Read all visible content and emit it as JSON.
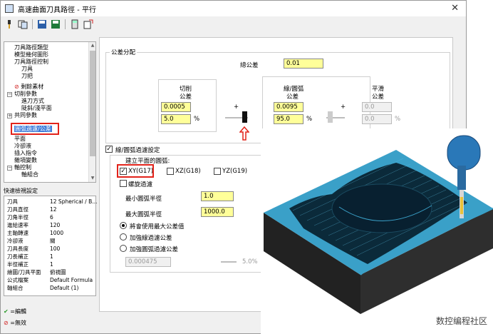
{
  "window": {
    "title": "高速曲面刀具路徑 - 平行"
  },
  "tree": {
    "items": [
      {
        "label": "刀具路徑類型"
      },
      {
        "label": "模型幾何圖形"
      },
      {
        "label": "刀具路徑控制"
      },
      {
        "label": "刀具"
      },
      {
        "label": "刀把"
      },
      {
        "label": "剩餘素材"
      },
      {
        "label": "切削參數"
      },
      {
        "label": "進刀方式"
      },
      {
        "label": "陡斜/淺平面"
      },
      {
        "label": "共同參數"
      },
      {
        "label": "圓弧過濾/公差"
      },
      {
        "label": "平面"
      },
      {
        "label": "冷卻液"
      },
      {
        "label": "插入指令"
      },
      {
        "label": "雜項變數"
      },
      {
        "label": "軸控制"
      },
      {
        "label": "軸組合"
      }
    ]
  },
  "quick_view": {
    "label": "快速檢視設定",
    "rows": [
      {
        "k": "刀具",
        "v": "12 Spherical / B..."
      },
      {
        "k": "刀具直徑",
        "v": "12"
      },
      {
        "k": "刀角半徑",
        "v": "6"
      },
      {
        "k": "進給速率",
        "v": "120"
      },
      {
        "k": "主軸轉速",
        "v": "1000"
      },
      {
        "k": "冷卻液",
        "v": "關"
      },
      {
        "k": "刀具長度",
        "v": "100"
      },
      {
        "k": "刀長補正",
        "v": "1"
      },
      {
        "k": "半徑補正",
        "v": "1"
      },
      {
        "k": "繪圖/刀具平面",
        "v": "俯視圖"
      },
      {
        "k": "公式檔案",
        "v": "Default Formula"
      },
      {
        "k": "軸組合",
        "v": "Default (1)"
      }
    ]
  },
  "legend": {
    "edited": "=編輯",
    "invalid": "=無效"
  },
  "tolerance": {
    "group_title": "公差分配",
    "total_label": "總公差",
    "total_value": "0.01",
    "cut_label_1": "切削",
    "cut_label_2": "公差",
    "cut_value": "0.0005",
    "cut_pct": "5.0",
    "pct": "%",
    "plus": "+",
    "line_label_1": "線/圓弧",
    "line_label_2": "公差",
    "line_value": "0.0095",
    "line_pct": "95.0",
    "smooth_label_1": "平滑",
    "smooth_label_2": "公差",
    "smooth_value": "0.0",
    "smooth_pct": "0.0"
  },
  "arc_filter": {
    "group_title": "線/圓弧過濾設定",
    "plane_label": "建立平面的圓弧:",
    "xy": "XY(G17)",
    "xz": "XZ(G18)",
    "yz": "YZ(G19)",
    "helix": "螺旋過濾",
    "min_radius_label": "最小圓弧半徑",
    "min_radius": "1.0",
    "max_radius_label": "最大圓弧半徑",
    "max_radius": "1000.0",
    "opt1": "將會使用最大公差值",
    "opt2": "加強線過濾公差",
    "opt3": "加強圓弧過濾公差",
    "disabled_value": "0.000475",
    "disabled_pct": "5.0%"
  },
  "watermark": "数控编程社区",
  "colors": {
    "yellow_field": "#ffff99",
    "highlight_red": "#e2231a",
    "select_blue": "#3d7bd9",
    "stock_teal": "#3aa0c8"
  }
}
